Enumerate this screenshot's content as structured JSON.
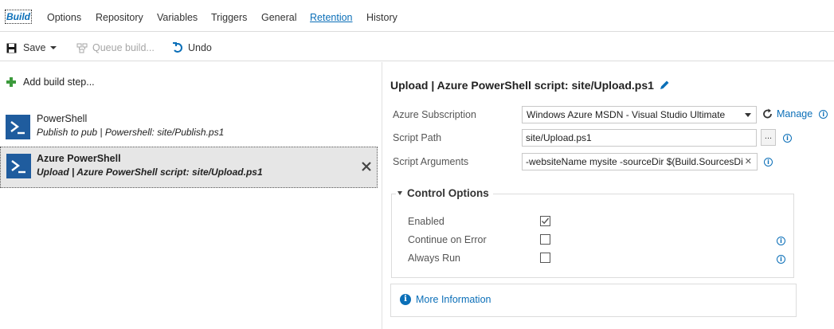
{
  "tabs": [
    {
      "label": "Build"
    },
    {
      "label": "Options"
    },
    {
      "label": "Repository"
    },
    {
      "label": "Variables"
    },
    {
      "label": "Triggers"
    },
    {
      "label": "General"
    },
    {
      "label": "Retention"
    },
    {
      "label": "History"
    }
  ],
  "toolbar": {
    "save_label": "Save",
    "queue_label": "Queue build...",
    "undo_label": "Undo"
  },
  "left": {
    "add_step_label": "Add build step...",
    "steps": [
      {
        "name": "PowerShell",
        "description": "Publish to pub | Powershell: site/Publish.ps1",
        "selected": false
      },
      {
        "name": "Azure PowerShell",
        "description": "Upload | Azure PowerShell script: site/Upload.ps1",
        "selected": true
      }
    ]
  },
  "right": {
    "title": "Upload | Azure PowerShell script: site/Upload.ps1",
    "fields": {
      "subscription_label": "Azure Subscription",
      "subscription_value": "Windows Azure MSDN - Visual Studio Ultimate",
      "manage_label": "Manage",
      "script_path_label": "Script Path",
      "script_path_value": "site/Upload.ps1",
      "browse_label": "...",
      "script_args_label": "Script Arguments",
      "script_args_value": "-websiteName mysite -sourceDir $(Build.SourcesDir"
    },
    "control_options": {
      "title": "Control Options",
      "options": [
        {
          "label": "Enabled",
          "checked": true
        },
        {
          "label": "Continue on Error",
          "checked": false
        },
        {
          "label": "Always Run",
          "checked": false
        }
      ]
    },
    "more_info_label": "More Information"
  },
  "colors": {
    "accent": "#0b6fb8",
    "powershell_icon": "#1f5c9e",
    "add_icon": "#3c9a3c",
    "selected_row": "#e6e6e6"
  }
}
